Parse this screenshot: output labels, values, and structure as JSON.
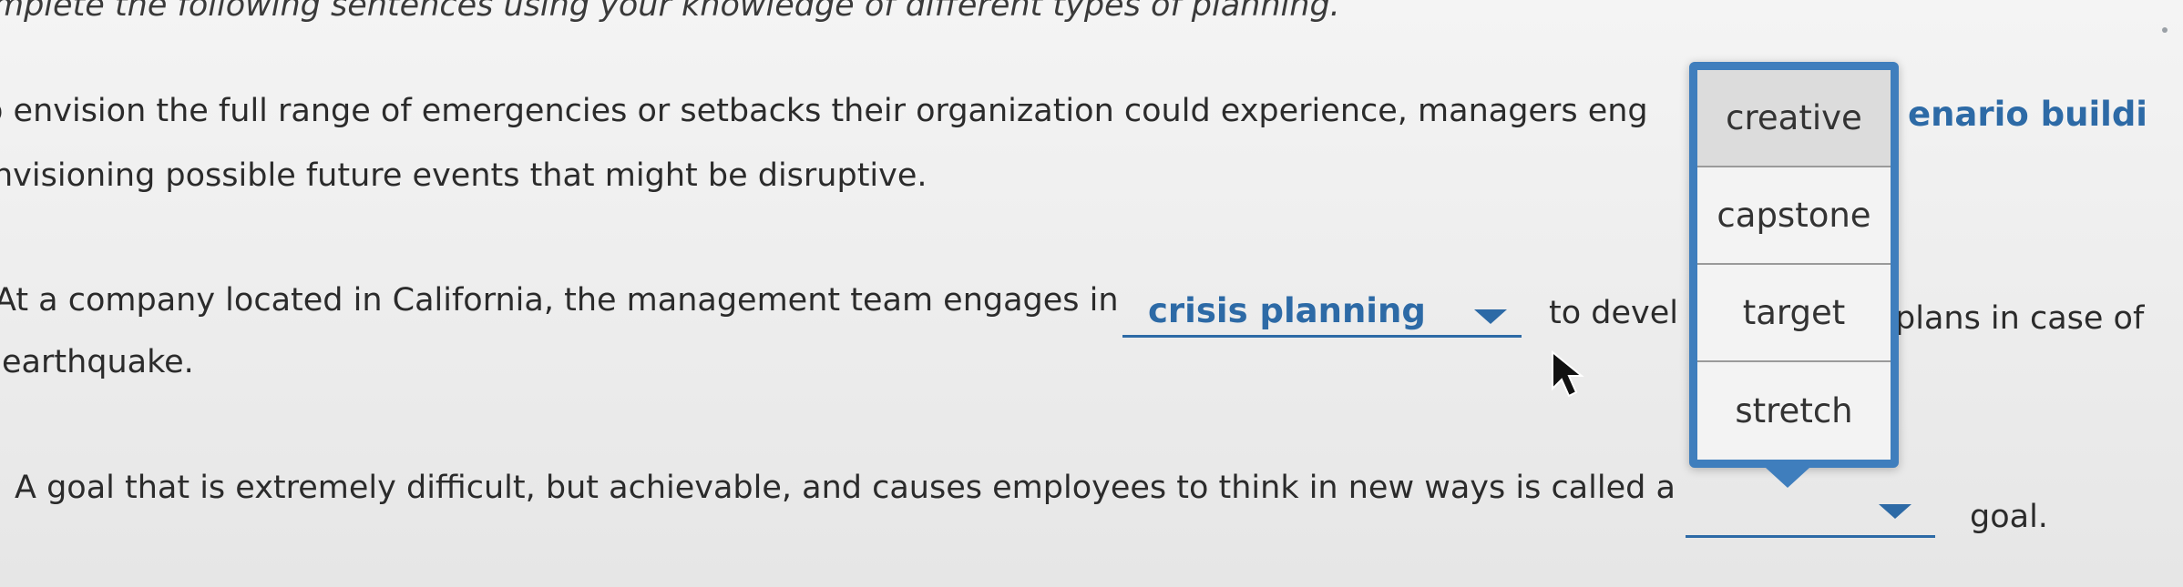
{
  "instruction": "mplete the following sentences using your knowledge of different types of planning.",
  "questions": {
    "q1_line1": "o envision the full range of emergencies or setbacks their organization could experience, managers eng",
    "q1_line2": "nvisioning possible future events that might be disruptive.",
    "q1_answer": "enario buildi",
    "q2_line1": "At a company located in California, the management team engages in",
    "q2_line2": "earthquake.",
    "q2_dropdown": "crisis planning",
    "q2_after": "to devel",
    "q2_tail": "plans in case of",
    "q3_line": "A goal that is extremely difficult, but achievable, and causes employees to think in new ways is called a",
    "q3_dropdown": "",
    "q3_after": "goal."
  },
  "popup": {
    "options": [
      "creative",
      "capstone",
      "target",
      "stretch"
    ],
    "highlighted": "creative"
  },
  "colors": {
    "accent": "#2d6aa6",
    "popup_border": "#3f7ebd"
  }
}
